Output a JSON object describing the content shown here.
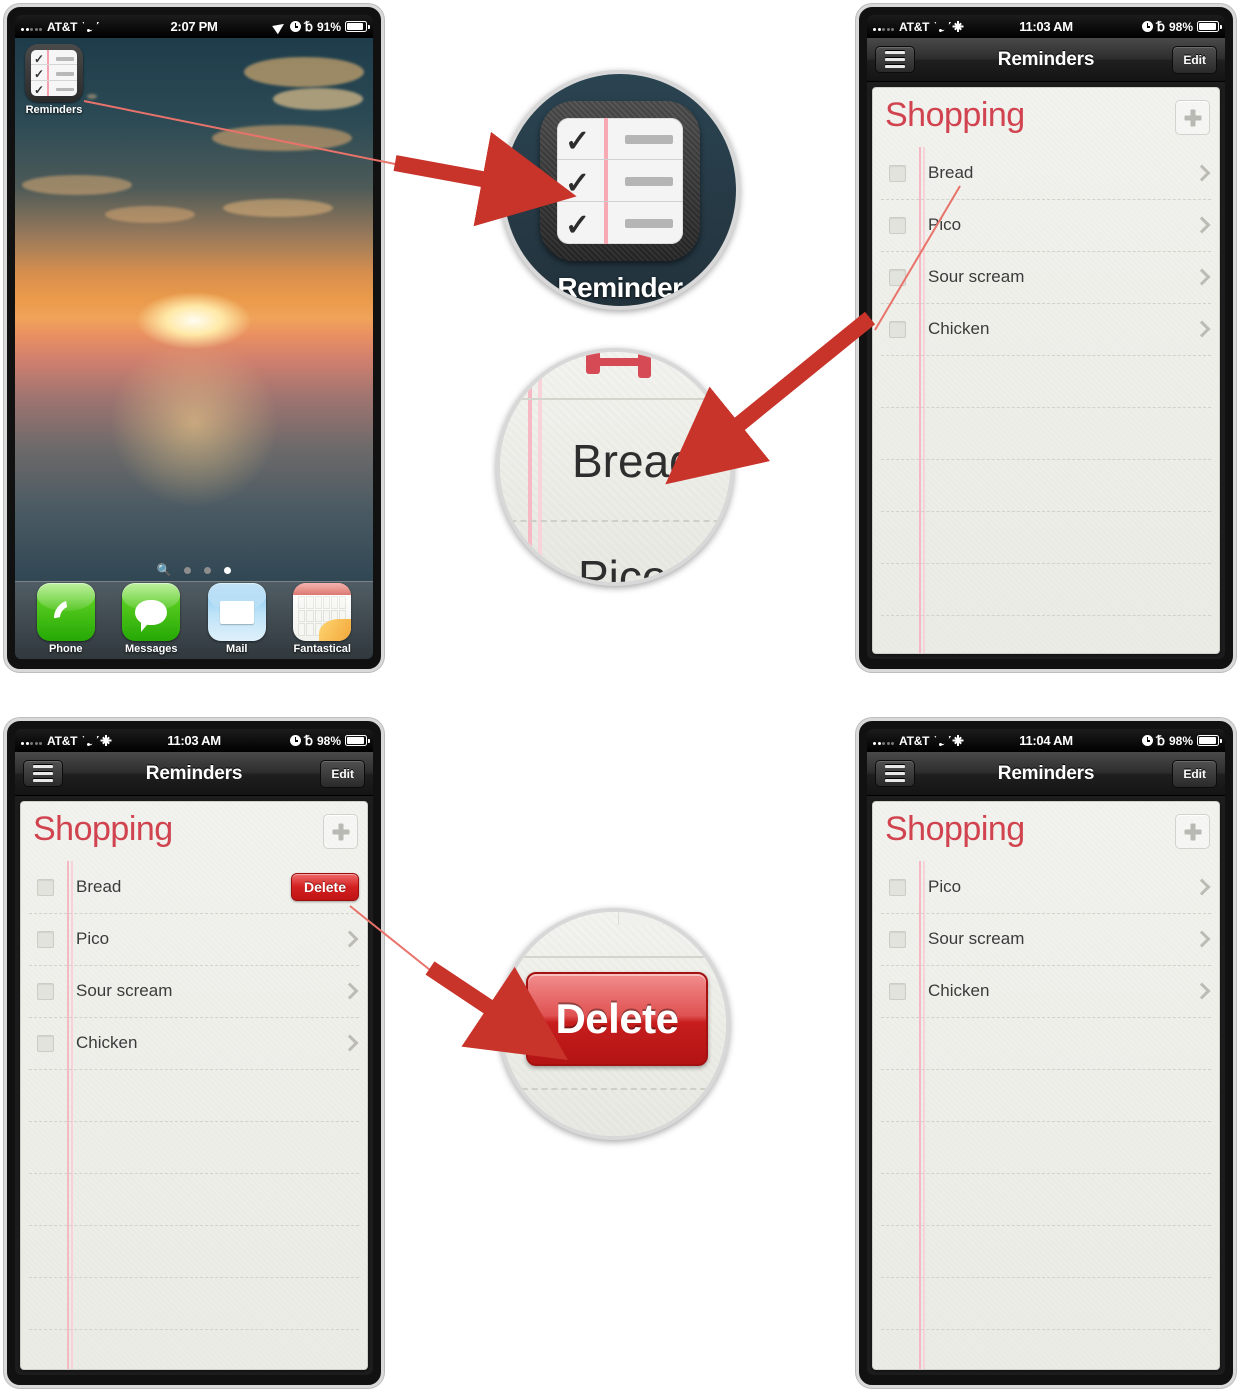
{
  "panels": {
    "home": {
      "status": {
        "carrier": "AT&T",
        "time": "2:07 PM",
        "battery": "91%",
        "icons": [
          "signal-dots",
          "wifi-icon",
          "location-arrow-icon",
          "clock-icon",
          "bluetooth-icon",
          "battery-icon"
        ]
      },
      "app_icon_label": "Reminders",
      "dock": [
        {
          "label": "Phone",
          "icon": "phone-handset-icon"
        },
        {
          "label": "Messages",
          "icon": "speech-bubble-icon"
        },
        {
          "label": "Mail",
          "icon": "envelope-icon"
        },
        {
          "label": "Fantastical",
          "icon": "calendar-icon"
        }
      ],
      "page_dots": 3,
      "active_dot": 3,
      "search_icon": "search-icon"
    },
    "list_full": {
      "status": {
        "carrier": "AT&T",
        "time": "11:03 AM",
        "battery": "98%",
        "icons": [
          "signal-dots",
          "wifi-icon",
          "sync-icon",
          "clock-icon",
          "bluetooth-icon",
          "battery-icon"
        ]
      },
      "nav": {
        "menu_icon": "hamburger-menu-icon",
        "title": "Reminders",
        "edit_label": "Edit"
      },
      "list_title": "Shopping",
      "add_icon": "plus-icon",
      "items": [
        {
          "label": "Bread",
          "checked": false,
          "accessory": "chevron-right-icon"
        },
        {
          "label": "Pico",
          "checked": false,
          "accessory": "chevron-right-icon"
        },
        {
          "label": "Sour scream",
          "checked": false,
          "accessory": "chevron-right-icon"
        },
        {
          "label": "Chicken",
          "checked": false,
          "accessory": "chevron-right-icon"
        }
      ]
    },
    "list_swiped": {
      "status": {
        "carrier": "AT&T",
        "time": "11:03 AM",
        "battery": "98%",
        "icons": [
          "signal-dots",
          "wifi-icon",
          "sync-icon",
          "clock-icon",
          "bluetooth-icon",
          "battery-icon"
        ]
      },
      "nav": {
        "menu_icon": "hamburger-menu-icon",
        "title": "Reminders",
        "edit_label": "Edit"
      },
      "list_title": "Shopping",
      "add_icon": "plus-icon",
      "delete_label": "Delete",
      "items": [
        {
          "label": "Bread",
          "checked": false,
          "accessory": "delete-button"
        },
        {
          "label": "Pico",
          "checked": false,
          "accessory": "chevron-right-icon"
        },
        {
          "label": "Sour scream",
          "checked": false,
          "accessory": "chevron-right-icon"
        },
        {
          "label": "Chicken",
          "checked": false,
          "accessory": "chevron-right-icon"
        }
      ]
    },
    "list_after_delete": {
      "status": {
        "carrier": "AT&T",
        "time": "11:04 AM",
        "battery": "98%",
        "icons": [
          "signal-dots",
          "wifi-icon",
          "sync-icon",
          "clock-icon",
          "bluetooth-icon",
          "battery-icon"
        ]
      },
      "nav": {
        "menu_icon": "hamburger-menu-icon",
        "title": "Reminders",
        "edit_label": "Edit"
      },
      "list_title": "Shopping",
      "add_icon": "plus-icon",
      "items": [
        {
          "label": "Pico",
          "checked": false,
          "accessory": "chevron-right-icon"
        },
        {
          "label": "Sour scream",
          "checked": false,
          "accessory": "chevron-right-icon"
        },
        {
          "label": "Chicken",
          "checked": false,
          "accessory": "chevron-right-icon"
        }
      ]
    }
  },
  "callouts": {
    "reminders_icon": {
      "label": "Reminder",
      "target": "reminders-app-icon"
    },
    "bread_row": {
      "label": "Bread",
      "target": "bread-list-row",
      "below": "Pico"
    },
    "delete_button": {
      "label": "Delete",
      "target": "delete-button"
    }
  },
  "colors": {
    "accent_red": "#d0434f",
    "delete_red": "#c71d1d",
    "arrow_red": "#c8332a",
    "paper": "#f1f1ec",
    "margin_pink": "#f5b9c3"
  }
}
